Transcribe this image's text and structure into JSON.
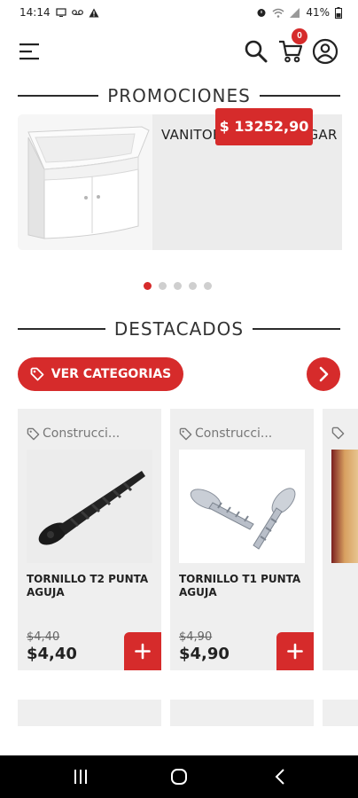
{
  "status": {
    "time": "14:14",
    "battery": "41%"
  },
  "header": {
    "cart_count": "0"
  },
  "promo": {
    "section_title": "PROMOCIONES",
    "product_name": "VANITORY ROMA COLGAR",
    "price": "$ 13252,90",
    "dots": 5,
    "active_dot": 0
  },
  "featured": {
    "section_title": "DESTACADOS",
    "categories_button": "VER CATEGORIAS"
  },
  "products": [
    {
      "category": "Construcci...",
      "name": "TORNILLO T2 PUNTA AGUJA",
      "old_price": "$4,40",
      "price": "$4,40"
    },
    {
      "category": "Construcci...",
      "name": "TORNILLO T1 PUNTA AGUJA",
      "old_price": "$4,90",
      "price": "$4,90"
    }
  ],
  "colors": {
    "accent": "#d62b2b",
    "card": "#efefef"
  },
  "icons": [
    "menu-icon",
    "search-icon",
    "cart-icon",
    "user-icon",
    "tag-icon",
    "chevron-right-icon",
    "plus-icon"
  ]
}
